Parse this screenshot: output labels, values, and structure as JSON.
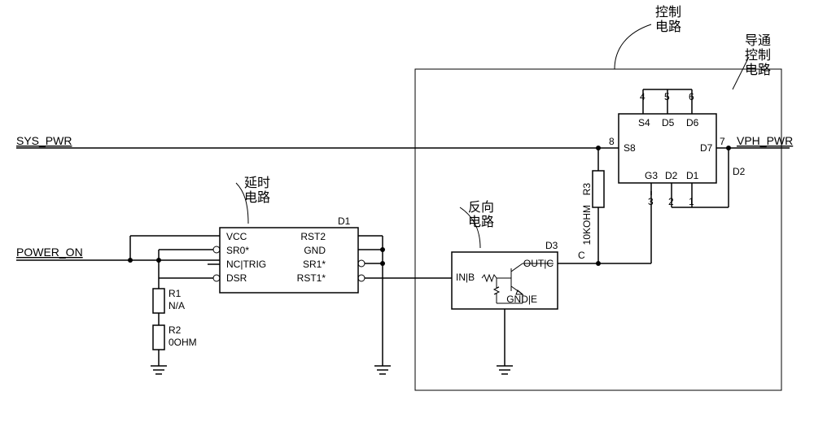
{
  "annotations": {
    "control_circuit": "控制\n电路",
    "conduction_control": "导通\n控制\n电路",
    "delay_circuit": "延时\n电路",
    "inverter_circuit": "反向\n电路"
  },
  "nets": {
    "sys_pwr": "SYS_PWR",
    "power_on": "POWER_ON",
    "vph_pwr": "VPH_PWR"
  },
  "delay_ic": {
    "ref": "D1",
    "pins": {
      "vcc": "VCC",
      "sr0": "SR0*",
      "nc_trig": "NC|TRIG",
      "dsr": "DSR",
      "rst2": "RST2",
      "gnd": "GND",
      "sr1": "SR1*",
      "rst1": "RST1*"
    }
  },
  "inverter": {
    "ref": "D3",
    "pins": {
      "in": "IN|B",
      "out": "OUT|C",
      "gnd": "GND|E"
    },
    "node": "C"
  },
  "switch": {
    "pins": {
      "p4": "4",
      "p5": "5",
      "p6": "6",
      "p8": "8",
      "p7": "7",
      "p3": "3",
      "p2": "2",
      "p1": "1",
      "s4": "S4",
      "d5": "D5",
      "d6": "D6",
      "s8": "S8",
      "d7": "D7",
      "g3": "G3",
      "d2_lower": "D2",
      "d1_lower": "D1",
      "d2_right": "D2"
    }
  },
  "resistors": {
    "r1": {
      "ref": "R1",
      "val": "N/A"
    },
    "r2": {
      "ref": "R2",
      "val": "0OHM"
    },
    "r3": {
      "ref": "R3",
      "val": "10KOHM"
    }
  }
}
